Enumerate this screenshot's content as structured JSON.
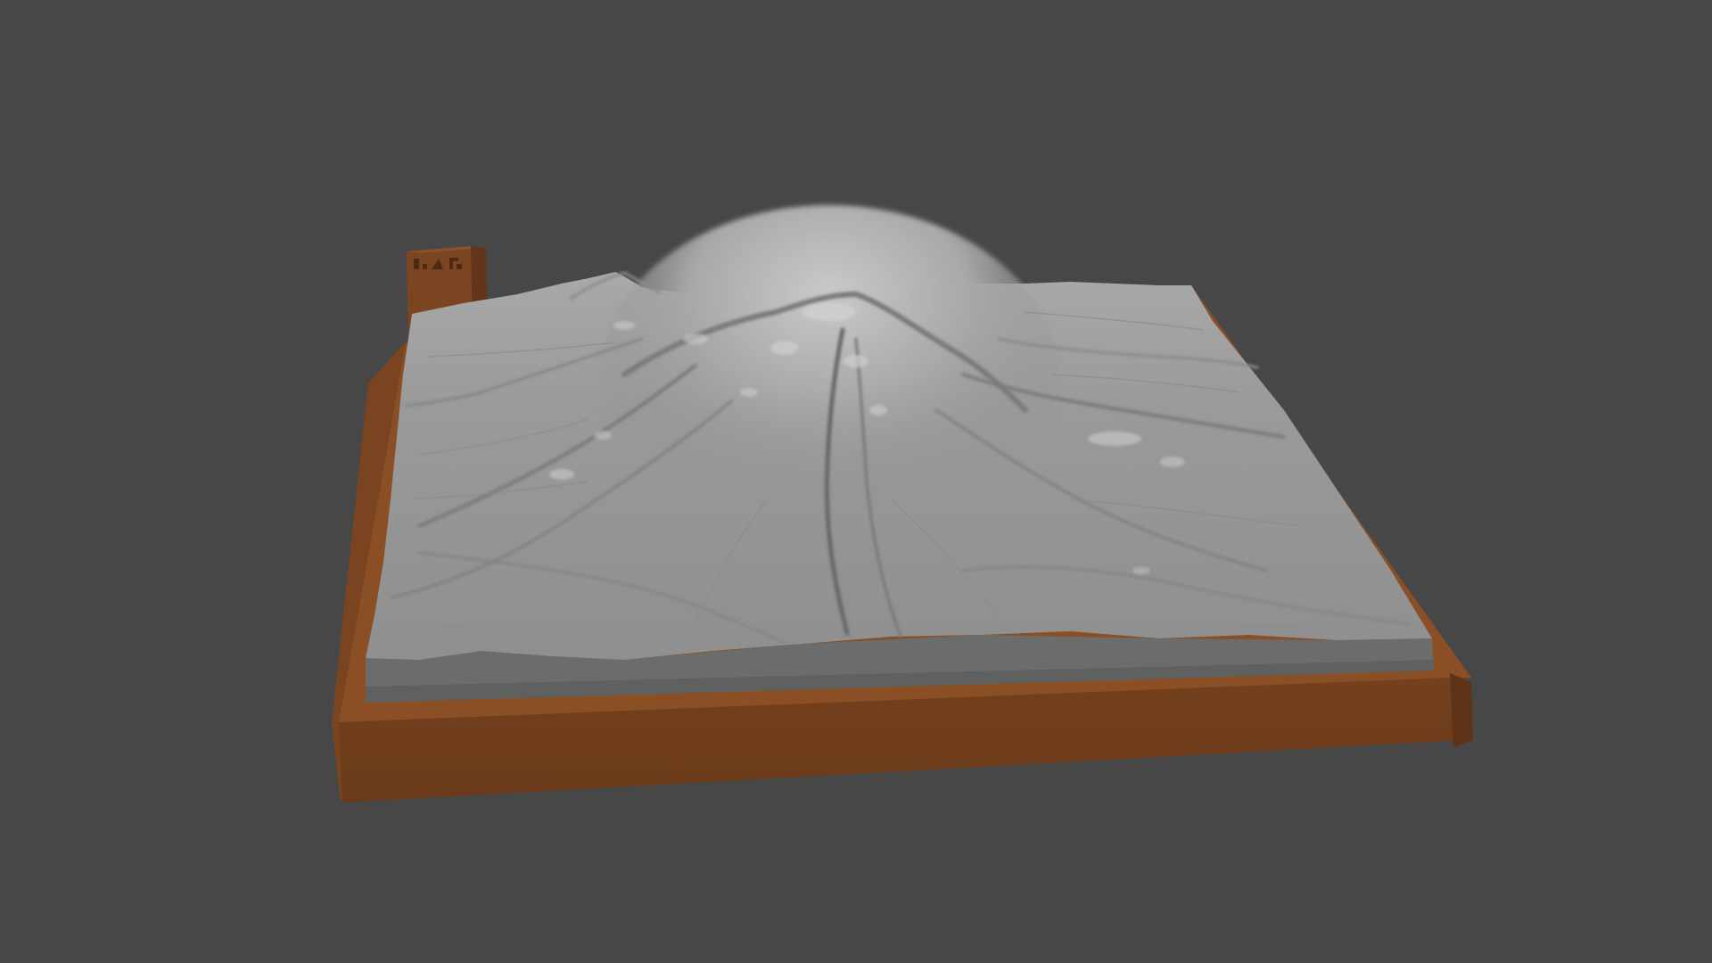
{
  "scene": {
    "subject": "terrain-relief-model",
    "colors": {
      "background": "#474747",
      "terrain_light": "#b4b4b4",
      "terrain_mid": "#9c9c9c",
      "terrain_dark": "#6e6e6e",
      "terrain_side": "#6b6c6c",
      "base_top": "#8a4f25",
      "base_front": "#6e3d1c",
      "base_side": "#7a4420",
      "tag_block": "#7c4522"
    },
    "icons": [
      "terrain-mesh",
      "wooden-base",
      "label-block"
    ]
  }
}
